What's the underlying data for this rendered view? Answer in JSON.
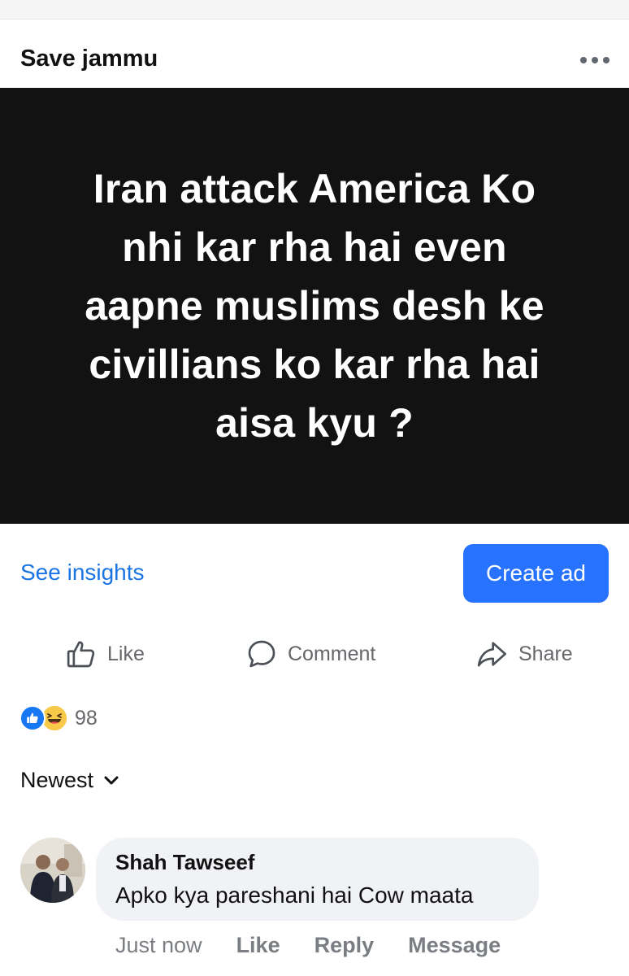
{
  "post": {
    "page_name": "Save jammu",
    "image_text_lines": [
      "Iran attack America Ko",
      "nhi kar rha hai even",
      "aapne muslims desh ke",
      "civillians ko kar rha hai",
      "aisa kyu ?"
    ],
    "more_icon": "more-horizontal-icon"
  },
  "insights": {
    "see_insights_label": "See insights",
    "create_ad_label": "Create ad"
  },
  "actions": {
    "like_label": "Like",
    "comment_label": "Comment",
    "share_label": "Share"
  },
  "reactions": {
    "count": "98",
    "types": [
      "like-reaction-icon",
      "haha-reaction-icon"
    ]
  },
  "comments_sort": {
    "label": "Newest"
  },
  "comment": {
    "author": "Shah Tawseef",
    "text": "Apko kya pareshani hai Cow maata",
    "time": "Just now",
    "like_label": "Like",
    "reply_label": "Reply",
    "message_label": "Message"
  },
  "colors": {
    "accent_blue": "#1b74e4",
    "button_blue": "#2773ff",
    "image_background": "#121212",
    "secondary_text": "#65676b",
    "bubble_background": "#f0f2f5"
  }
}
